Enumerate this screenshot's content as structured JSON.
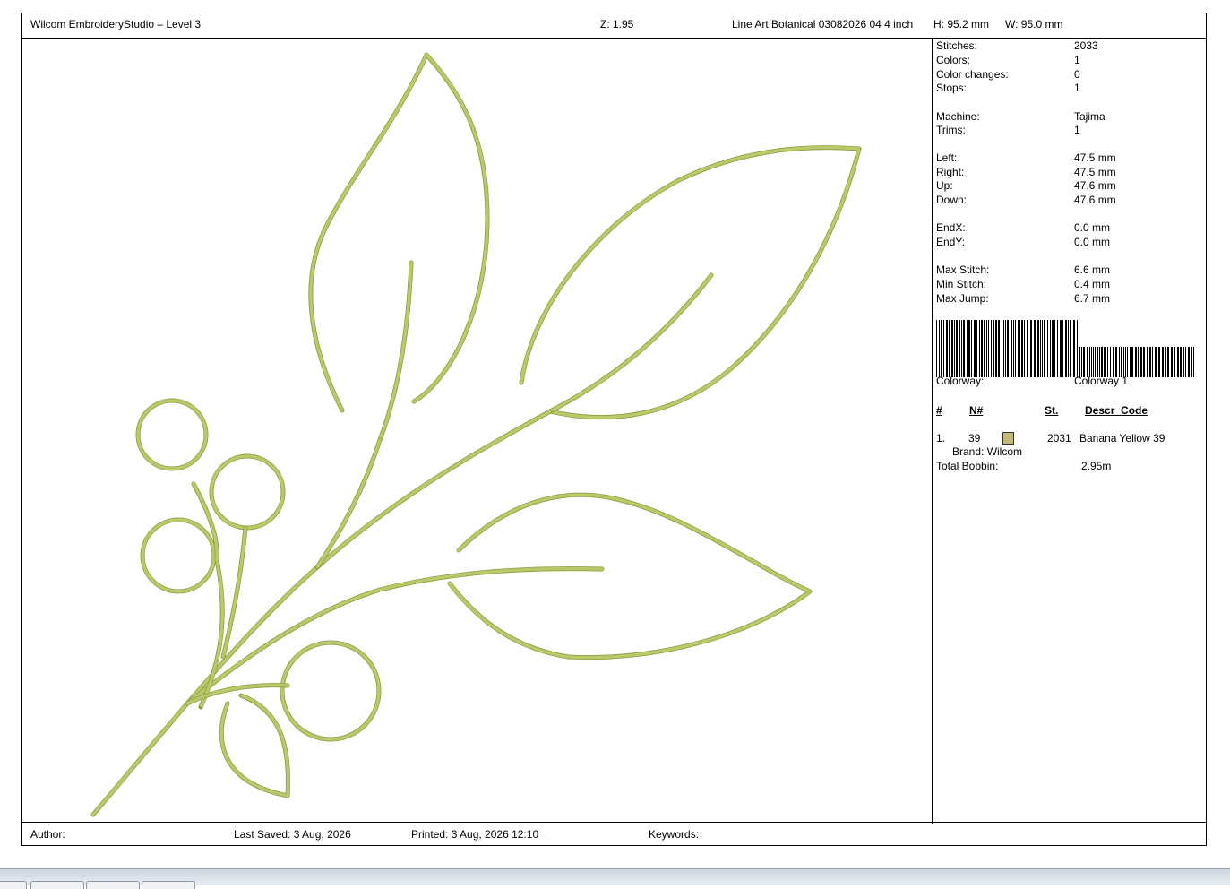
{
  "header": {
    "app_title": "Wilcom EmbroideryStudio – Level 3",
    "zoom": "Z: 1.95",
    "design_name": "Line Art Botanical 03082026 04 4 inch",
    "height": "H: 95.2 mm",
    "width": "W: 95.0 mm"
  },
  "stats": {
    "stitches_label": "Stitches:",
    "stitches": "2033",
    "colors_label": "Colors:",
    "colors": "1",
    "color_changes_label": "Color changes:",
    "color_changes": "0",
    "stops_label": "Stops:",
    "stops": "1",
    "machine_label": "Machine:",
    "machine": "Tajima",
    "trims_label": "Trims:",
    "trims": "1",
    "left_label": "Left:",
    "left": "47.5 mm",
    "right_label": "Right:",
    "right": "47.5 mm",
    "up_label": "Up:",
    "up": "47.6 mm",
    "down_label": "Down:",
    "down": "47.6 mm",
    "endx_label": "EndX:",
    "endx": "0.0 mm",
    "endy_label": "EndY:",
    "endy": "0.0 mm",
    "max_stitch_label": "Max Stitch:",
    "max_stitch": "6.6 mm",
    "min_stitch_label": "Min Stitch:",
    "min_stitch": "0.4 mm",
    "max_jump_label": "Max Jump:",
    "max_jump": "6.7 mm"
  },
  "colorway": {
    "label": "Colorway:",
    "value": "Colorway 1"
  },
  "thread_table": {
    "headers": {
      "num": "#",
      "n": "N#",
      "st": "St.",
      "descr": "Descr_Code"
    },
    "rows": [
      {
        "index": "1.",
        "code": "39",
        "swatch_color": "#c2b97a",
        "stitches": "2031",
        "description": "Banana Yellow 39",
        "brand": "Brand: Wilcom"
      }
    ]
  },
  "bobbin": {
    "label": "Total Bobbin:",
    "value": "2.95m"
  },
  "footer": {
    "author_label": "Author:",
    "last_saved": "Last Saved:  3 Aug, 2026",
    "printed": "Printed:  3 Aug, 2026 12:10",
    "keywords_label": "Keywords:"
  },
  "design": {
    "thread_color": "#bcc96b",
    "thread_shadow": "#8e9a3e"
  }
}
